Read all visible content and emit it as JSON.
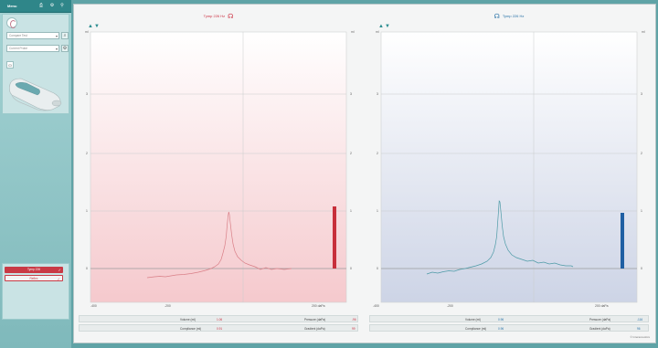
{
  "sidebar": {
    "title": "Menu",
    "protocol_select": "Compare Test",
    "probe_select": "Current Probe",
    "tests": [
      {
        "label": "Tymp 226",
        "check": "✓"
      },
      {
        "label": "Reflex",
        "check": "✓"
      }
    ]
  },
  "left_panel": {
    "title": "Tymp 226 Hz",
    "y_unit_left": "ml",
    "y_unit_right": "ml",
    "y_ticks": [
      "4",
      "3",
      "2",
      "1",
      "0"
    ],
    "x_ticks": [
      "-400",
      "-200",
      "0",
      "200 daPa"
    ],
    "info": {
      "volume_label": "Volume (ml)",
      "volume_value": "1.06",
      "pressure_label": "Pressure (daPa)",
      "pressure_value": "-96",
      "compliance_label": "Compliance (ml)",
      "compliance_value": "0.91",
      "gradient_label": "Gradient (daPa)",
      "gradient_value": "99"
    },
    "color": "#cc3344"
  },
  "right_panel": {
    "title": "Tymp 226 Hz",
    "y_unit_left": "ml",
    "y_unit_right": "ml",
    "y_ticks": [
      "4",
      "3",
      "2",
      "1",
      "0"
    ],
    "x_ticks": [
      "-400",
      "-200",
      "0",
      "200 daPa"
    ],
    "info": {
      "volume_label": "Volume (ml)",
      "volume_value": "0.96",
      "pressure_label": "Pressure (daPa)",
      "pressure_value": "-116",
      "compliance_label": "Compliance (ml)",
      "compliance_value": "0.96",
      "gradient_label": "Gradient (daPa)",
      "gradient_value": "96"
    },
    "color": "#2a73a8"
  },
  "footer": {
    "brand": "© Interacoustics"
  }
}
